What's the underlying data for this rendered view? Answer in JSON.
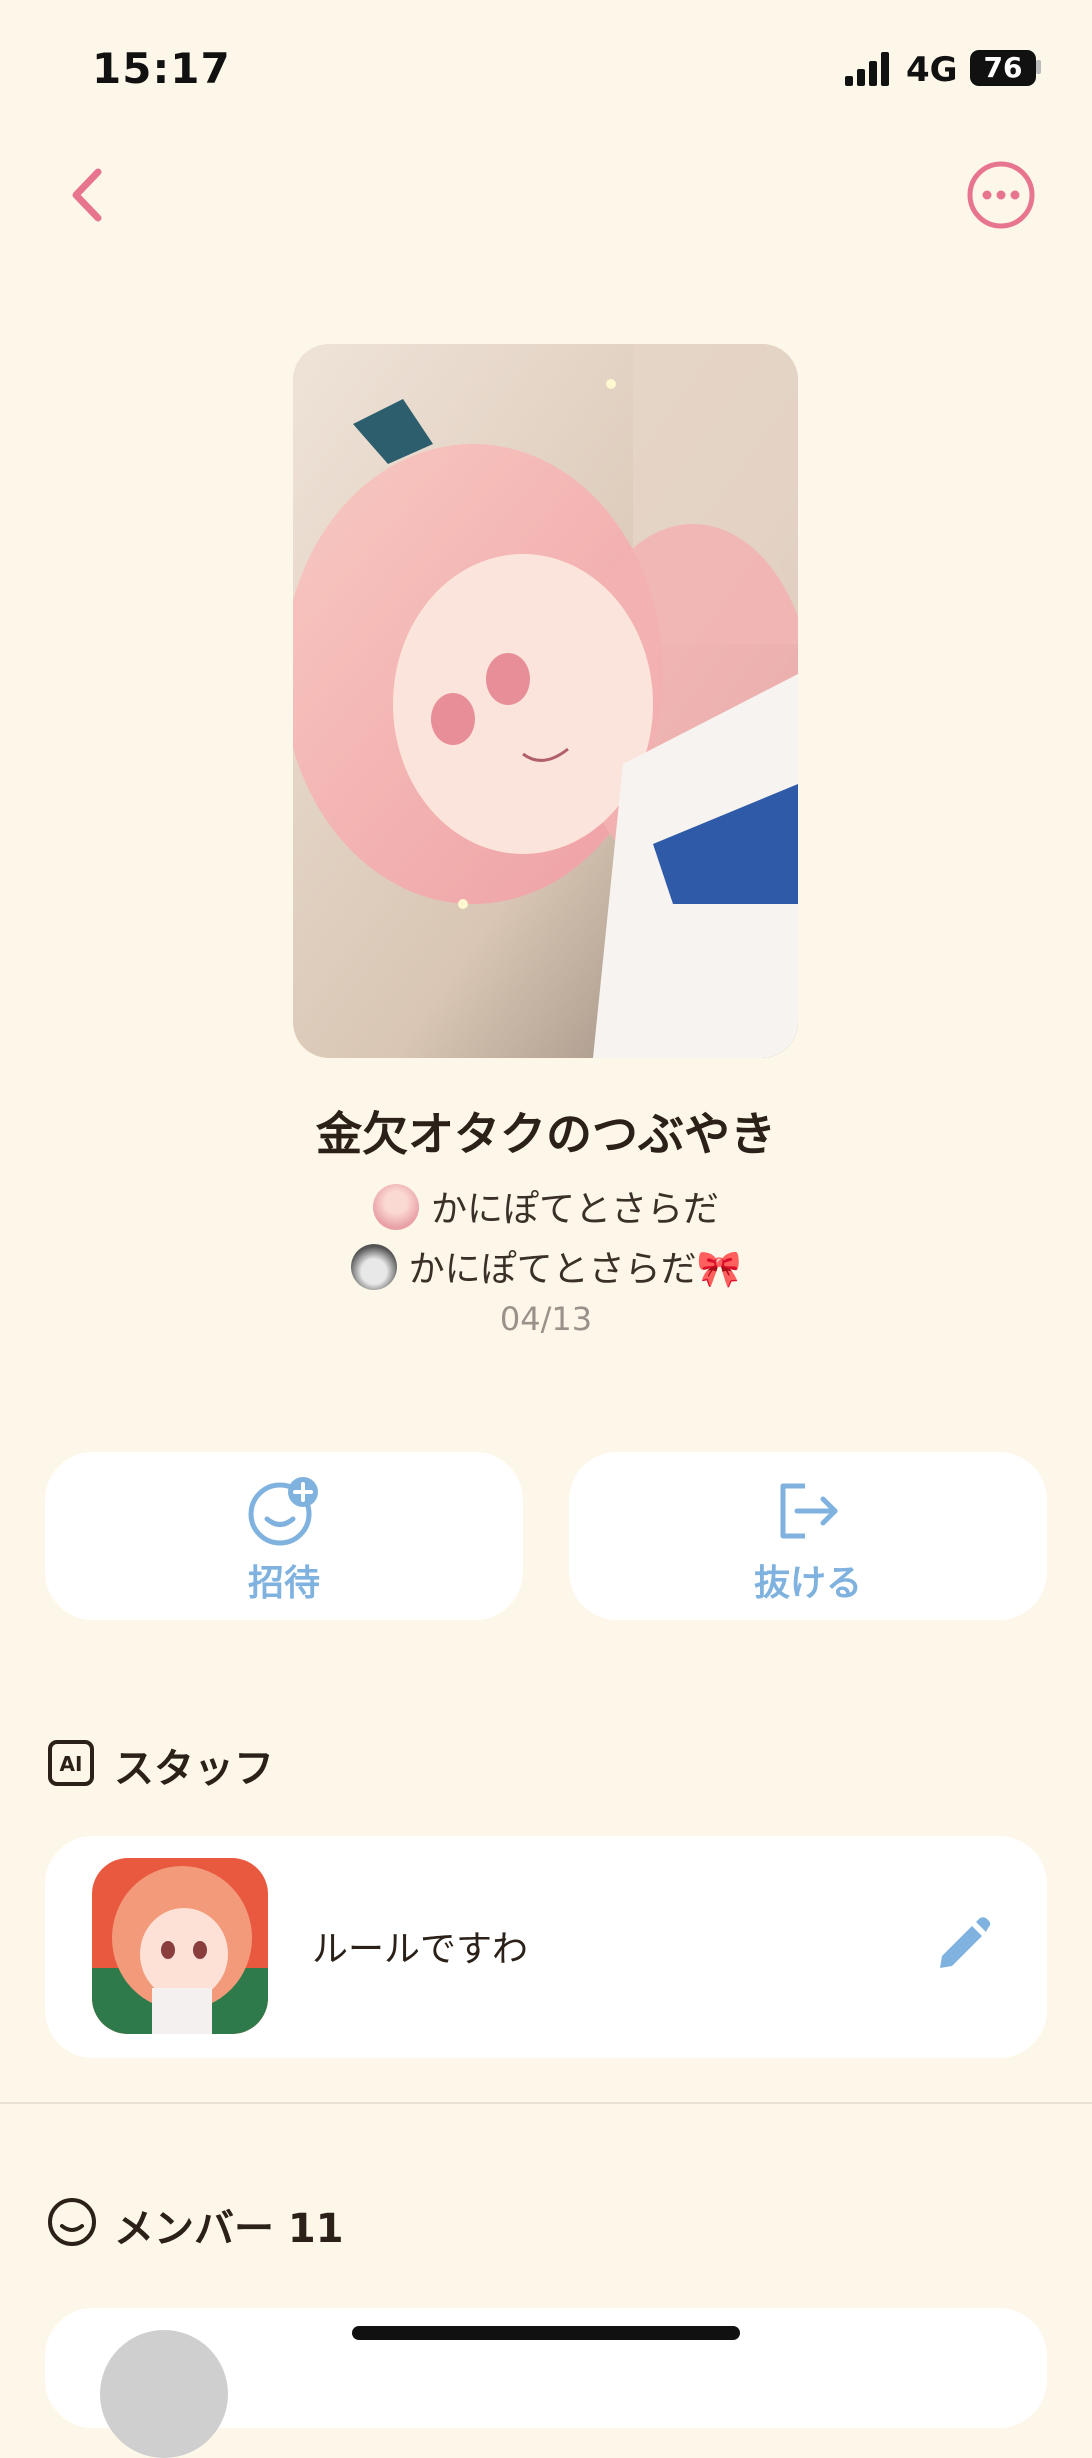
{
  "status_bar": {
    "time": "15:17",
    "network": "4G",
    "battery": "76"
  },
  "nav": {
    "back_icon": "chevron-left-icon",
    "more_icon": "ellipsis-circle-icon"
  },
  "group": {
    "title": "金欠オタクのつぶやき",
    "owners": [
      {
        "name": "かにぽてとさらだ"
      },
      {
        "name": "かにぽてとさらだ🎀"
      }
    ],
    "date": "04/13"
  },
  "actions": {
    "invite_label": "招待",
    "leave_label": "抜ける"
  },
  "staff": {
    "section_title": "スタッフ",
    "ai_badge": "AI",
    "name": "ルールですわ"
  },
  "members": {
    "section_title": "メンバー 11"
  },
  "colors": {
    "accent_pink": "#e8758f",
    "accent_blue": "#7fb2de",
    "background": "#fdf7e9"
  }
}
